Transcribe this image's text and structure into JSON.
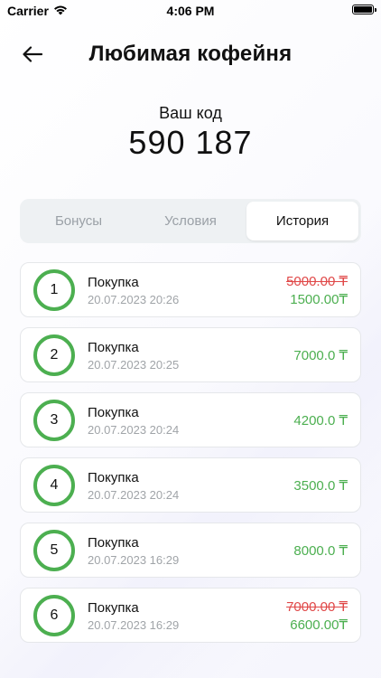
{
  "status_bar": {
    "carrier": "Carrier",
    "time": "4:06 PM",
    "wifi_icon": "wifi-icon",
    "battery_icon": "battery-icon"
  },
  "header": {
    "back_icon": "arrow-left-icon",
    "title": "Любимая кофейня"
  },
  "code": {
    "label": "Ваш код",
    "value": "590 187"
  },
  "tabs": [
    {
      "label": "Бонусы",
      "active": false
    },
    {
      "label": "Условия",
      "active": false
    },
    {
      "label": "История",
      "active": true
    }
  ],
  "history": [
    {
      "number": "1",
      "title": "Покупка",
      "date": "20.07.2023 20:26",
      "old_amount": "5000.00 ₸",
      "amount": "1500.00₸"
    },
    {
      "number": "2",
      "title": "Покупка",
      "date": "20.07.2023 20:25",
      "old_amount": "",
      "amount": "7000.0 ₸"
    },
    {
      "number": "3",
      "title": "Покупка",
      "date": "20.07.2023 20:24",
      "old_amount": "",
      "amount": "4200.0 ₸"
    },
    {
      "number": "4",
      "title": "Покупка",
      "date": "20.07.2023 20:24",
      "old_amount": "",
      "amount": "3500.0 ₸"
    },
    {
      "number": "5",
      "title": "Покупка",
      "date": "20.07.2023 16:29",
      "old_amount": "",
      "amount": "8000.0 ₸"
    },
    {
      "number": "6",
      "title": "Покупка",
      "date": "20.07.2023 16:29",
      "old_amount": "7000.00 ₸",
      "amount": "6600.00₸"
    }
  ],
  "colors": {
    "accent_green": "#4caf50",
    "strike_red": "#e04848",
    "tab_bg": "#eef1f3"
  }
}
